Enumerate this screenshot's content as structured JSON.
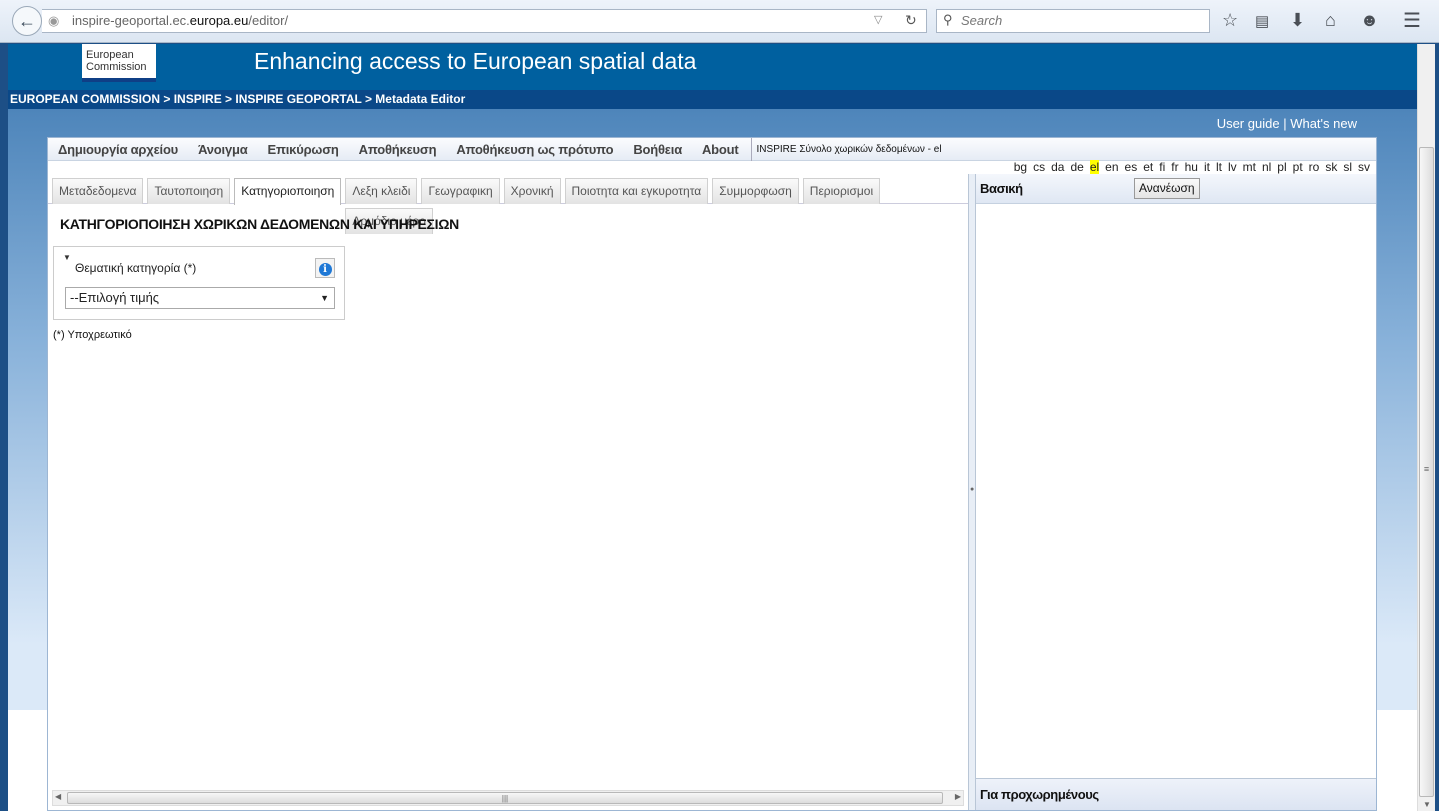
{
  "browser": {
    "url_prefix": "inspire-geoportal.ec.",
    "url_domain": "europa.eu",
    "url_suffix": "/editor/",
    "search_placeholder": "Search"
  },
  "header": {
    "logo_line1": "European",
    "logo_line2": "Commission",
    "title": "Enhancing access to European spatial data",
    "breadcrumb": "EUROPEAN COMMISSION > INSPIRE > INSPIRE GEOPORTAL > Metadata Editor",
    "user_guide": "User guide",
    "separator": "|",
    "whats_new": "What's new"
  },
  "menu": {
    "items": [
      "Δημιουργία αρχείου",
      "Άνοιγμα",
      "Επικύρωση",
      "Αποθήκευση",
      "Αποθήκευση ως πρότυπο",
      "Βοήθεια",
      "About"
    ],
    "document_title": "INSPIRE Σύνολο χωρικών δεδομένων - el"
  },
  "languages": {
    "items": [
      "bg",
      "cs",
      "da",
      "de",
      "el",
      "en",
      "es",
      "et",
      "fi",
      "fr",
      "hu",
      "it",
      "lt",
      "lv",
      "mt",
      "nl",
      "pl",
      "pt",
      "ro",
      "sk",
      "sl",
      "sv"
    ],
    "selected": "el",
    "highlight_color": "#ffff00"
  },
  "tabs": {
    "items": [
      "Μεταδεδομενα",
      "Ταυτοποιηση",
      "Κατηγοριοποιηση",
      "Λεξη κλειδι",
      "Γεωγραφικη",
      "Χρονική",
      "Ποιοτητα και εγκυροτητα",
      "Συμμορφωση",
      "Περιορισμοι",
      "Αρμόδιο μέρο"
    ],
    "active": "Κατηγοριοποιηση"
  },
  "content": {
    "title": "ΚΑΤΗΓΟΡΙΟΠΟΙΗΣΗ ΧΩΡΙΚΩΝ ΔΕΔΟΜΕΝΩΝ ΚΑΙ ΥΠΗΡΕΣΙΩΝ",
    "field_label": "Θεματική κατηγορία (*)",
    "select_value": "--Επιλογή τιμής",
    "required_note": "(*) Υποχρεωτικό"
  },
  "right_panel": {
    "title": "Βασική",
    "refresh_button": "Ανανέωση",
    "footer": "Για προχωρημένους"
  },
  "colors": {
    "banner": "#00609f",
    "breadcrumb_bar": "#0a4888",
    "info_icon": "#1e78d6"
  }
}
